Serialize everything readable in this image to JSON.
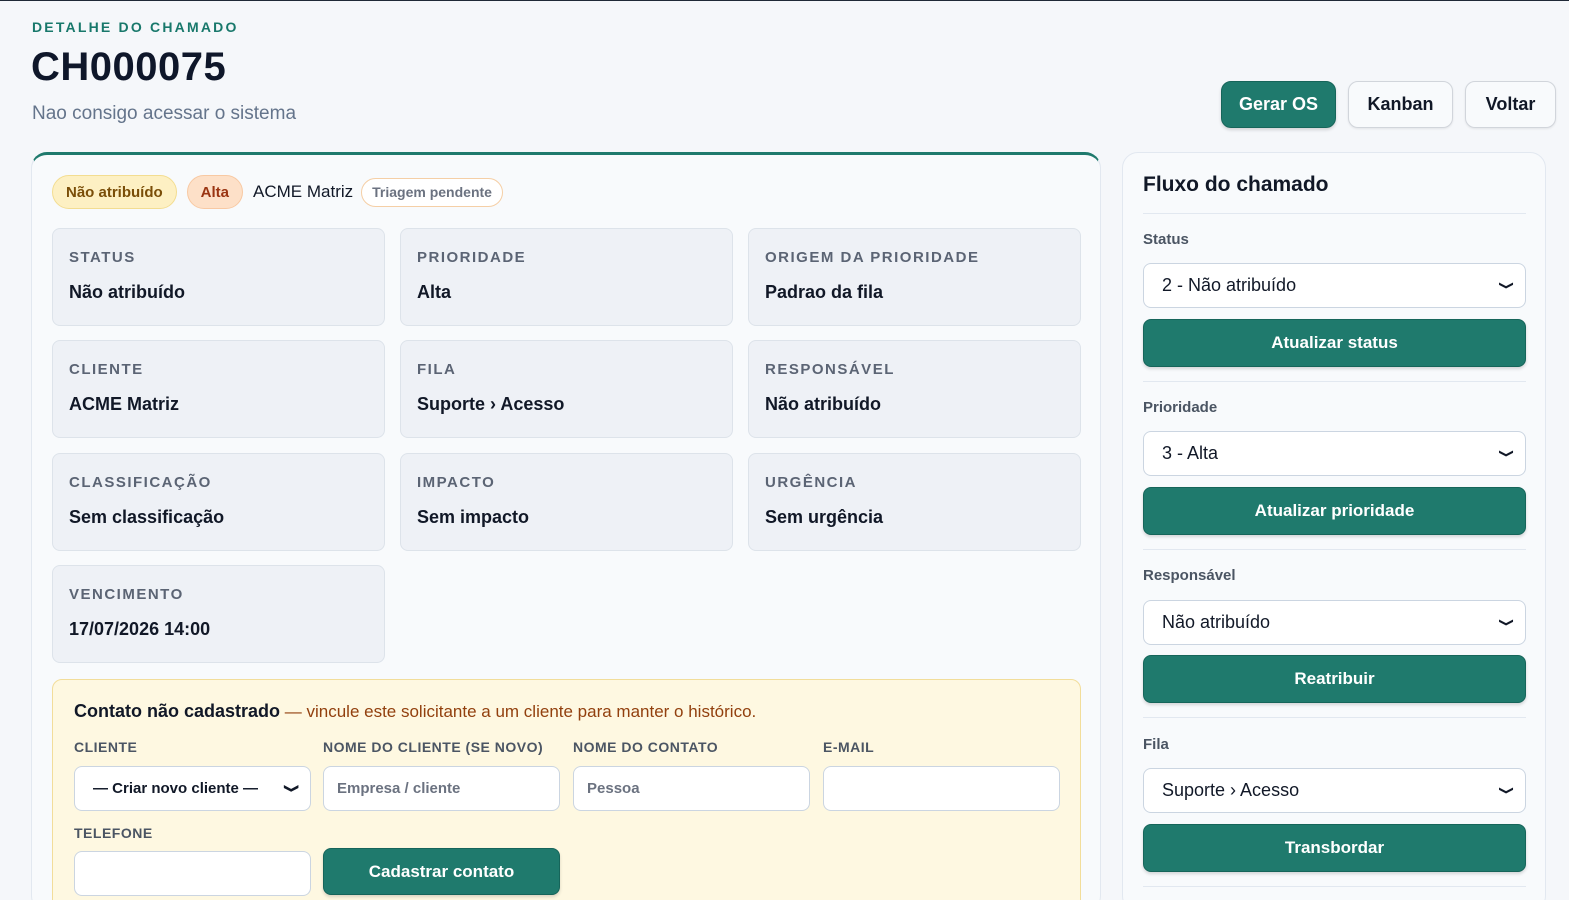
{
  "header": {
    "eyebrow": "DETALHE DO CHAMADO",
    "ticket_id": "CH000075",
    "subtitle": "Nao consigo acessar o sistema",
    "actions": {
      "generate_os": "Gerar OS",
      "kanban": "Kanban",
      "back": "Voltar"
    }
  },
  "badges": {
    "status": "Não atribuído",
    "priority": "Alta",
    "client": "ACME Matriz",
    "triage": "Triagem pendente"
  },
  "info": [
    {
      "label": "STATUS",
      "value": "Não atribuído"
    },
    {
      "label": "PRIORIDADE",
      "value": "Alta"
    },
    {
      "label": "ORIGEM DA PRIORIDADE",
      "value": "Padrao da fila"
    },
    {
      "label": "CLIENTE",
      "value": "ACME Matriz"
    },
    {
      "label": "FILA",
      "value": "Suporte › Acesso"
    },
    {
      "label": "RESPONSÁVEL",
      "value": "Não atribuído"
    },
    {
      "label": "CLASSIFICAÇÃO",
      "value": "Sem classificação"
    },
    {
      "label": "IMPACTO",
      "value": "Sem impacto"
    },
    {
      "label": "URGÊNCIA",
      "value": "Sem urgência"
    },
    {
      "label": "VENCIMENTO",
      "value": "17/07/2026 14:00"
    }
  ],
  "contact": {
    "title_strong": "Contato não cadastrado",
    "title_rest": " — vincule este solicitante a um cliente para manter o histórico.",
    "client_label": "CLIENTE",
    "client_value": "— Criar novo cliente —",
    "new_client_label": "NOME DO CLIENTE (SE NOVO)",
    "new_client_placeholder": "Empresa / cliente",
    "contact_name_label": "NOME DO CONTATO",
    "contact_name_placeholder": "Pessoa",
    "email_label": "E-MAIL",
    "email_value": "",
    "phone_label": "TELEFONE",
    "phone_value": "",
    "submit": "Cadastrar contato"
  },
  "flow": {
    "title": "Fluxo do chamado",
    "status_label": "Status",
    "status_value": "2 - Não atribuído",
    "status_button": "Atualizar status",
    "priority_label": "Prioridade",
    "priority_value": "3 - Alta",
    "priority_button": "Atualizar prioridade",
    "owner_label": "Responsável",
    "owner_value": "Não atribuído",
    "owner_button": "Reatribuir",
    "queue_label": "Fila",
    "queue_value": "Suporte › Acesso",
    "queue_button": "Transbordar"
  },
  "icons": {
    "select_arrow": "chevron-down-icon"
  },
  "colors": {
    "accent": "#1f7a6d",
    "warning_bg": "#fef8e1",
    "status_badge_bg": "#fdf0c3",
    "priority_badge_bg": "#fde0c8"
  }
}
